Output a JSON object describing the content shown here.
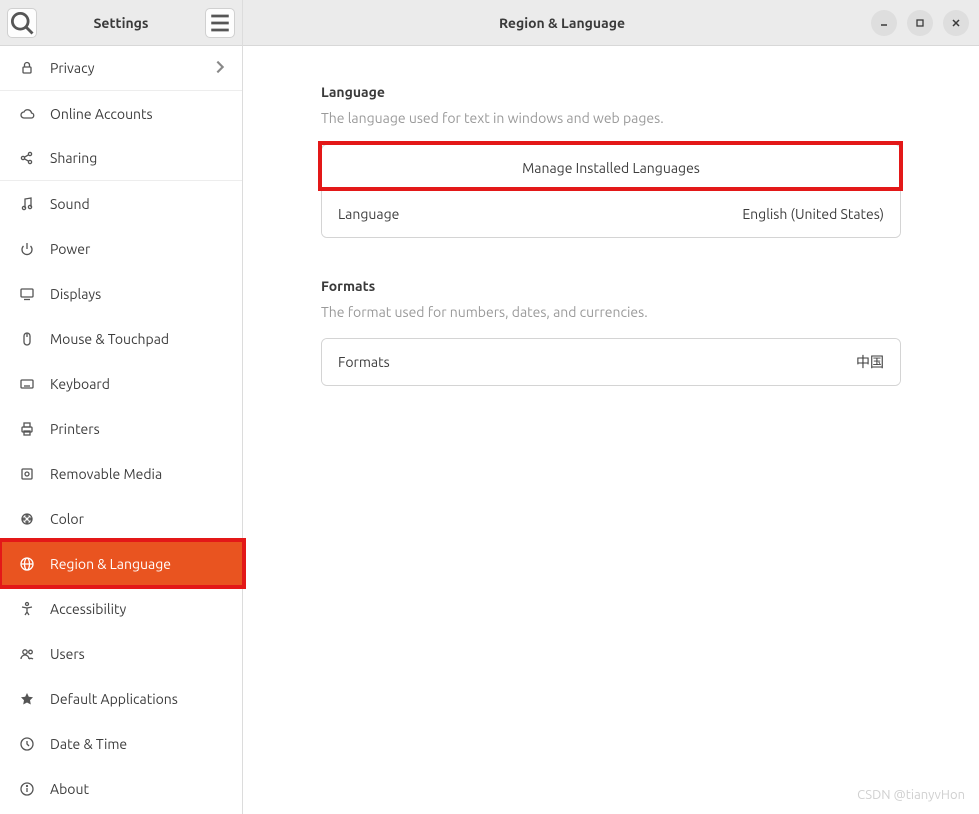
{
  "sidebar": {
    "title": "Settings",
    "items": [
      {
        "label": "Privacy",
        "icon": "lock",
        "chevron": true,
        "divider": true
      },
      {
        "label": "Online Accounts",
        "icon": "cloud"
      },
      {
        "label": "Sharing",
        "icon": "share",
        "divider": true
      },
      {
        "label": "Sound",
        "icon": "music"
      },
      {
        "label": "Power",
        "icon": "power"
      },
      {
        "label": "Displays",
        "icon": "display"
      },
      {
        "label": "Mouse & Touchpad",
        "icon": "mouse"
      },
      {
        "label": "Keyboard",
        "icon": "keyboard"
      },
      {
        "label": "Printers",
        "icon": "printer"
      },
      {
        "label": "Removable Media",
        "icon": "media"
      },
      {
        "label": "Color",
        "icon": "color"
      },
      {
        "label": "Region & Language",
        "icon": "globe",
        "active": true,
        "highlight": true
      },
      {
        "label": "Accessibility",
        "icon": "accessibility"
      },
      {
        "label": "Users",
        "icon": "users"
      },
      {
        "label": "Default Applications",
        "icon": "star"
      },
      {
        "label": "Date & Time",
        "icon": "clock"
      },
      {
        "label": "About",
        "icon": "info"
      }
    ]
  },
  "main": {
    "title": "Region & Language",
    "language": {
      "heading": "Language",
      "description": "The language used for text in windows and web pages.",
      "manage_button": "Manage Installed Languages",
      "row_label": "Language",
      "row_value": "English (United States)"
    },
    "formats": {
      "heading": "Formats",
      "description": "The format used for numbers, dates, and currencies.",
      "row_label": "Formats",
      "row_value": "中国"
    }
  },
  "watermark": "CSDN @tianyvHon"
}
